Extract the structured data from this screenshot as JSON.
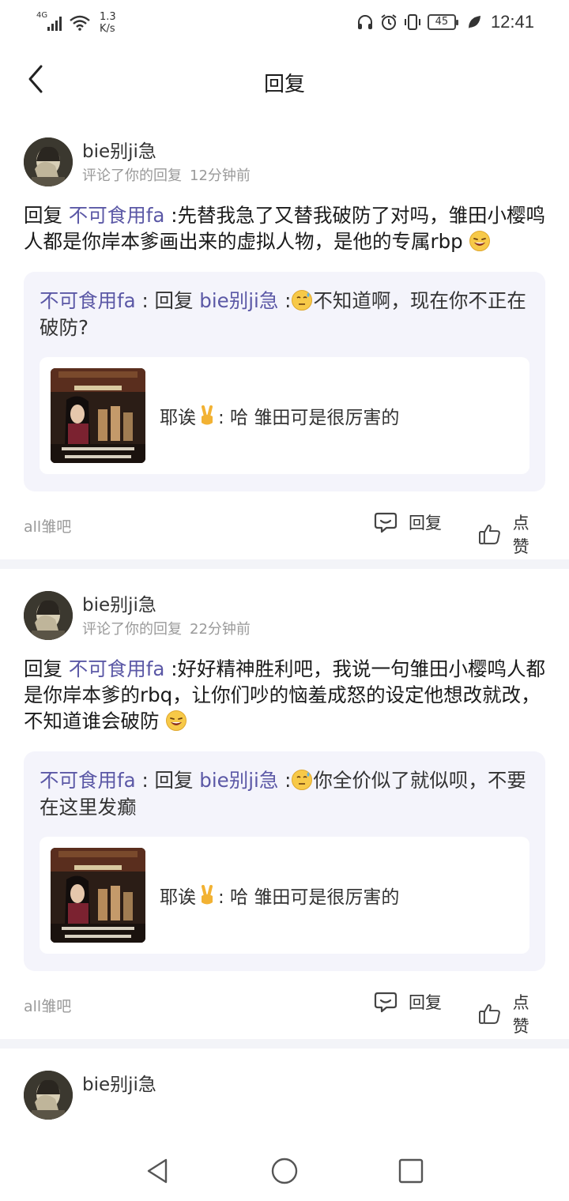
{
  "status_bar": {
    "network": "4G",
    "speed_value": "1.3",
    "speed_unit": "K/s",
    "battery": "45",
    "time": "12:41"
  },
  "header": {
    "title": "回复"
  },
  "cards": [
    {
      "author": "bie别ji急",
      "action_text": "评论了你的回复",
      "time_ago": "12分钟前",
      "reply_prefix": "回复",
      "reply_mention": "不可食用fa",
      "reply_body": ":先替我急了又替我破防了对吗，雏田小樱鸣人都是你岸本爹画出来的虚拟人物，是他的专属rbp",
      "quote_user": "不可食用fa",
      "quote_sep": ": 回复",
      "quote_mention": "bie别ji急",
      "quote_colon": ":",
      "quote_body": "不知道啊，现在你不正在破防?",
      "orig_user": "耶诶",
      "orig_body": ": 哈 雏田可是很厉害的",
      "forum": "all雏吧",
      "reply_label": "回复",
      "like_label": "点赞"
    },
    {
      "author": "bie别ji急",
      "action_text": "评论了你的回复",
      "time_ago": "22分钟前",
      "reply_prefix": "回复",
      "reply_mention": "不可食用fa",
      "reply_body": ":好好精神胜利吧，我说一句雏田小樱鸣人都是你岸本爹的rbq，让你们吵的恼羞成怒的设定他想改就改，不知道谁会破防",
      "quote_user": "不可食用fa",
      "quote_sep": ": 回复",
      "quote_mention": "bie别ji急",
      "quote_colon": ":",
      "quote_body": "你全价似了就似呗，不要在这里发癫",
      "orig_user": "耶诶",
      "orig_body": ": 哈 雏田可是很厉害的",
      "forum": "all雏吧",
      "reply_label": "回复",
      "like_label": "点赞"
    },
    {
      "author": "bie别ji急"
    }
  ],
  "icons": {
    "back": "chevron-left-icon",
    "reply": "chat-bubble-icon",
    "like": "thumbs-up-icon",
    "nav_back": "triangle-back-icon",
    "nav_home": "circle-home-icon",
    "nav_recent": "square-recent-icon"
  },
  "colors": {
    "mention": "#5b58a6",
    "quote_bg": "#f4f4fb",
    "meta": "#9a9a9a"
  }
}
